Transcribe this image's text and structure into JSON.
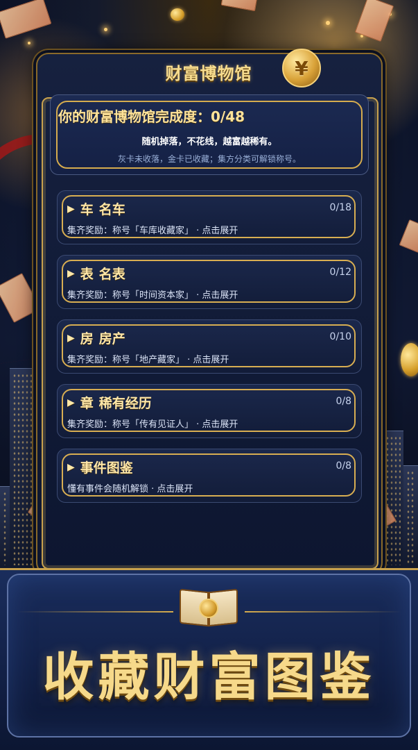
{
  "header": {
    "title": "财富博物馆",
    "coin_symbol": "¥"
  },
  "progress": {
    "title": "你的财富博物馆完成度：0/48",
    "line1": "随机掉落，不花线，越富越稀有。",
    "line2": "灰卡未收落，金卡已收藏；集方分类可解锁称号。"
  },
  "categories": [
    {
      "icon": "▶",
      "short": "车",
      "name": "名车",
      "count": "0/18",
      "desc": "集齐奖励：称号「车库收藏家」 · 点击展开"
    },
    {
      "icon": "▶",
      "short": "表",
      "name": "名表",
      "count": "0/12",
      "desc": "集齐奖励：称号「时间资本家」 · 点击展开"
    },
    {
      "icon": "▶",
      "short": "房",
      "name": "房产",
      "count": "0/10",
      "desc": "集齐奖励：称号「地产藏家」 · 点击展开"
    },
    {
      "icon": "▶",
      "short": "章",
      "name": "稀有经历",
      "count": "0/8",
      "desc": "集齐奖励：称号「传有见证人」 · 点击展开"
    },
    {
      "icon": "▶",
      "short": "事件图鉴",
      "name": "",
      "count": "0/8",
      "desc": "懂有事件会随机解锁 · 点击展开"
    }
  ],
  "banner": {
    "title": "收藏财富图鉴"
  },
  "colors": {
    "gold": "#d6ac4e",
    "panel_bg": "#16213f",
    "banner_bg": "#1a2d5c"
  }
}
